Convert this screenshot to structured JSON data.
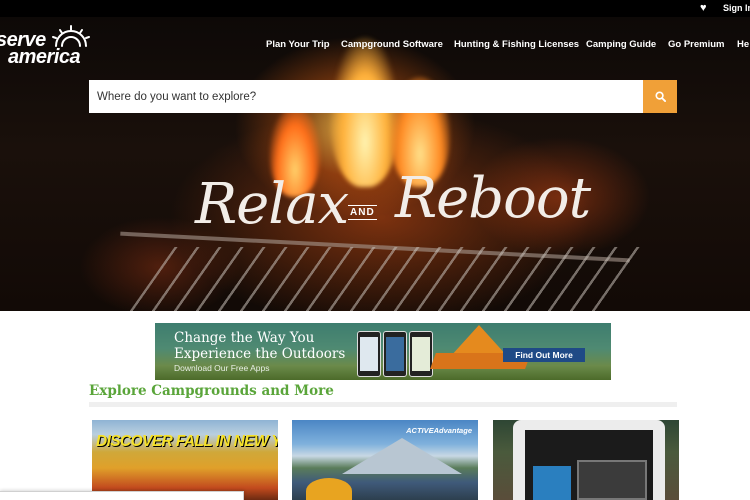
{
  "topbar": {
    "favorites_icon": "heart-icon",
    "signin_label": "Sign In"
  },
  "logo": {
    "line1": "serve",
    "line2": "america",
    "icon": "sunrise-icon"
  },
  "nav": {
    "items": [
      {
        "label": "Plan Your Trip"
      },
      {
        "label": "Campground Software"
      },
      {
        "label": "Hunting & Fishing Licenses"
      },
      {
        "label": "Camping Guide"
      },
      {
        "label": "Go Premium"
      },
      {
        "label": "He"
      }
    ]
  },
  "search": {
    "placeholder": "Where do you want to explore?",
    "value": "",
    "button_icon": "search-icon",
    "button_color": "#f0a038"
  },
  "hero": {
    "title_left": "Relax",
    "title_and": "AND",
    "title_right": "Reboot"
  },
  "ad": {
    "headline_line1": "Change the Way You",
    "headline_line2": "Experience the Outdoors",
    "subline": "Download Our Free Apps",
    "cta_label": "Find Out More",
    "cta_color": "#1f4a86"
  },
  "section": {
    "title": "Explore Campgrounds and More",
    "title_color": "#5aa53a"
  },
  "cards": [
    {
      "text": "DISCOVER FALL IN NEW YORK"
    },
    {
      "brand": "ACTIVEAdvantage"
    },
    {}
  ]
}
